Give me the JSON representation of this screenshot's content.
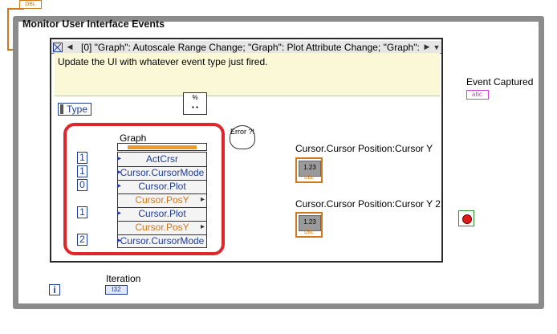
{
  "loop": {
    "title": "Monitor User Interface Events"
  },
  "event_structure": {
    "selector": "[0] \"Graph\": Autoscale Range Change;  \"Graph\": Plot Attribute Change;  \"Graph\":",
    "description": "Update the UI with whatever event type just fired.",
    "type_label": "Type"
  },
  "property_node": {
    "label": "Graph",
    "rows": [
      {
        "name": "ActCrsr",
        "mode": "write"
      },
      {
        "name": "Cursor.CursorMode",
        "mode": "write"
      },
      {
        "name": "Cursor.Plot",
        "mode": "write"
      },
      {
        "name": "Cursor.PosY",
        "mode": "read"
      },
      {
        "name": "Cursor.Plot",
        "mode": "write"
      },
      {
        "name": "Cursor.PosY",
        "mode": "read"
      },
      {
        "name": "Cursor.CursorMode",
        "mode": "write"
      }
    ],
    "constants": [
      "1",
      "1",
      "0",
      "1",
      "2"
    ]
  },
  "error_node": {
    "text": "Error ?!"
  },
  "format_node": {
    "text": "%"
  },
  "indicators": {
    "cursor_y": {
      "label": "Cursor.Cursor Position:Cursor Y",
      "value": "1.23",
      "type": "DBL"
    },
    "cursor_y2": {
      "label": "Cursor.Cursor Position:Cursor Y 2",
      "value": "1.23",
      "type": "DBL"
    }
  },
  "event_captured": {
    "label": "Event Captured",
    "type": "abc"
  },
  "iteration": {
    "label": "Iteration",
    "type": "I32",
    "index": "i"
  },
  "top_terminal": {
    "type": "DBL"
  },
  "colors": {
    "loop_border": "#8c8c8c",
    "highlight": "#e0262b",
    "numeric_wire": "#d2781a",
    "string_wire": "#d33fd3",
    "int_wire": "#1f3c9a"
  }
}
